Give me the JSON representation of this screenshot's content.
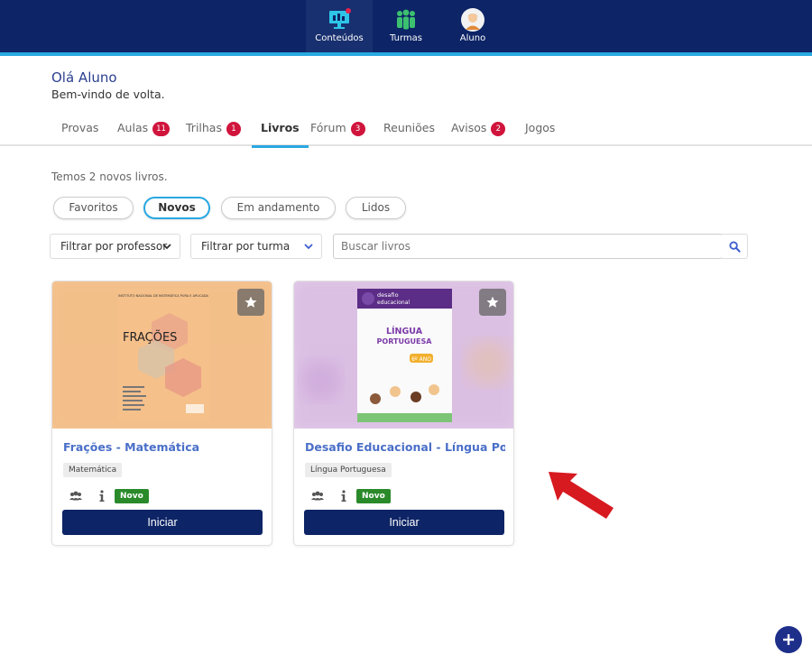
{
  "nav": {
    "items": [
      {
        "label": "Conteúdos",
        "icon": "monitor-icon",
        "active": true
      },
      {
        "label": "Turmas",
        "icon": "group-icon",
        "active": false
      },
      {
        "label": "Aluno",
        "icon": "avatar-icon",
        "active": false
      }
    ]
  },
  "greeting": {
    "title": "Olá Aluno",
    "subtitle": "Bem-vindo de volta."
  },
  "tabs": [
    {
      "label": "Provas",
      "badge": ""
    },
    {
      "label": "Aulas",
      "badge": "11"
    },
    {
      "label": "Trilhas",
      "badge": "1"
    },
    {
      "label": "Livros",
      "badge": "",
      "active": true
    },
    {
      "label": "Fórum",
      "badge": "3"
    },
    {
      "label": "Reuniões",
      "badge": ""
    },
    {
      "label": "Avisos",
      "badge": "2"
    },
    {
      "label": "Jogos",
      "badge": ""
    }
  ],
  "info_text": "Temos 2 novos livros.",
  "filters": {
    "pills": [
      {
        "label": "Favoritos"
      },
      {
        "label": "Novos",
        "active": true
      },
      {
        "label": "Em andamento"
      },
      {
        "label": "Lidos"
      }
    ],
    "professor": "Filtrar por professor",
    "turma": "Filtrar por turma",
    "search_placeholder": "Buscar livros"
  },
  "books": [
    {
      "title": "Frações - Matemática",
      "tag": "Matemática",
      "status": "Novo",
      "button": "Iniciar",
      "cover": {
        "header": "INSTITUTO NACIONAL DE MATEMÁTICA PURA E APLICADA",
        "title": "FRAÇÕES",
        "color": "#f5c08a"
      }
    },
    {
      "title": "Desafio Educacional - Língua Portu...",
      "tag": "Língua Portuguesa",
      "status": "Novo",
      "button": "Iniciar",
      "cover": {
        "brand": "desafio educacional",
        "title": "LÍNGUA PORTUGUESA",
        "grade": "6º ANO",
        "color": "#d8b8e6"
      }
    }
  ],
  "colors": {
    "navy": "#0d2466",
    "accent": "#29a8e0",
    "badge": "#d0143c",
    "novo": "#2a8a2a",
    "link": "#4a6fc8"
  }
}
